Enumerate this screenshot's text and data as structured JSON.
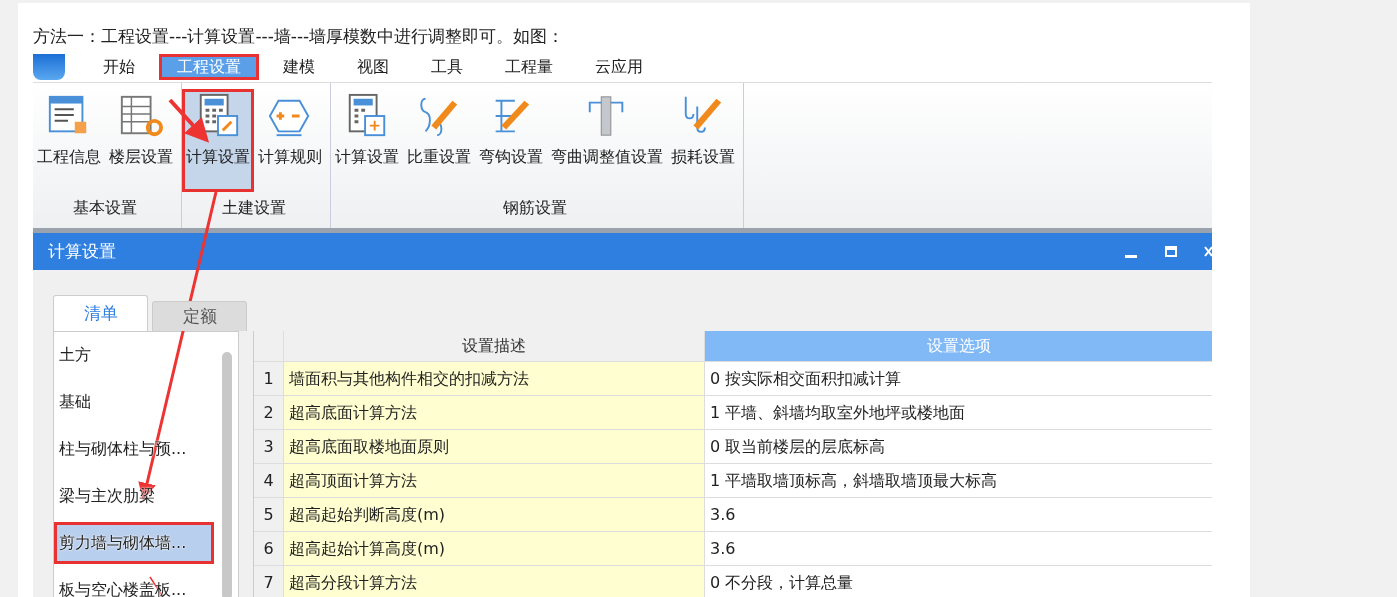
{
  "intro": "方法一：工程设置---计算设置---墙---墙厚模数中进行调整即可。如图：",
  "menu": {
    "tabs": [
      {
        "label": "开始",
        "selected": false,
        "highlighted": false
      },
      {
        "label": "工程设置",
        "selected": true,
        "highlighted": true
      },
      {
        "label": "建模",
        "selected": false,
        "highlighted": false
      },
      {
        "label": "视图",
        "selected": false,
        "highlighted": false
      },
      {
        "label": "工具",
        "selected": false,
        "highlighted": false
      },
      {
        "label": "工程量",
        "selected": false,
        "highlighted": false
      },
      {
        "label": "云应用",
        "selected": false,
        "highlighted": false
      }
    ]
  },
  "ribbon": {
    "groups": [
      {
        "label": "基本设置",
        "items": [
          {
            "label": "工程信息",
            "selected": false,
            "highlighted": false
          },
          {
            "label": "楼层设置",
            "selected": false,
            "highlighted": false
          }
        ]
      },
      {
        "label": "土建设置",
        "items": [
          {
            "label": "计算设置",
            "selected": true,
            "highlighted": true
          },
          {
            "label": "计算规则",
            "selected": false,
            "highlighted": false
          }
        ]
      },
      {
        "label": "钢筋设置",
        "items": [
          {
            "label": "计算设置",
            "selected": false,
            "highlighted": false
          },
          {
            "label": "比重设置",
            "selected": false,
            "highlighted": false
          },
          {
            "label": "弯钩设置",
            "selected": false,
            "highlighted": false
          },
          {
            "label": "弯曲调整值设置",
            "selected": false,
            "highlighted": false
          },
          {
            "label": "损耗设置",
            "selected": false,
            "highlighted": false
          }
        ]
      }
    ]
  },
  "dialog": {
    "title": "计算设置",
    "tabs": [
      {
        "label": "清单",
        "selected": true
      },
      {
        "label": "定额",
        "selected": false
      }
    ],
    "categories": [
      {
        "label": "土方",
        "selected": false,
        "highlighted": false
      },
      {
        "label": "基础",
        "selected": false,
        "highlighted": false
      },
      {
        "label": "柱与砌体柱与预...",
        "selected": false,
        "highlighted": false
      },
      {
        "label": "梁与主次肋梁",
        "selected": false,
        "highlighted": false
      },
      {
        "label": "剪力墙与砌体墙...",
        "selected": true,
        "highlighted": true
      },
      {
        "label": "板与空心楼盖板...",
        "selected": false,
        "highlighted": false
      }
    ],
    "table": {
      "columns": [
        {
          "label": "设置描述",
          "selected": false
        },
        {
          "label": "设置选项",
          "selected": true
        }
      ],
      "rows": [
        {
          "number": "1",
          "description": "墙面积与其他构件相交的扣减方法",
          "option": "0 按实际相交面积扣减计算"
        },
        {
          "number": "2",
          "description": "超高底面计算方法",
          "option": "1 平墙、斜墙均取室外地坪或楼地面"
        },
        {
          "number": "3",
          "description": "超高底面取楼地面原则",
          "option": "0 取当前楼层的层底标高"
        },
        {
          "number": "4",
          "description": "超高顶面计算方法",
          "option": "1 平墙取墙顶标高，斜墙取墙顶最大标高"
        },
        {
          "number": "5",
          "description": "超高起始判断高度(m)",
          "option": "3.6"
        },
        {
          "number": "6",
          "description": "超高起始计算高度(m)",
          "option": "3.6"
        },
        {
          "number": "7",
          "description": "超高分段计算方法",
          "option": "0 不分段，计算总量"
        }
      ]
    }
  }
}
